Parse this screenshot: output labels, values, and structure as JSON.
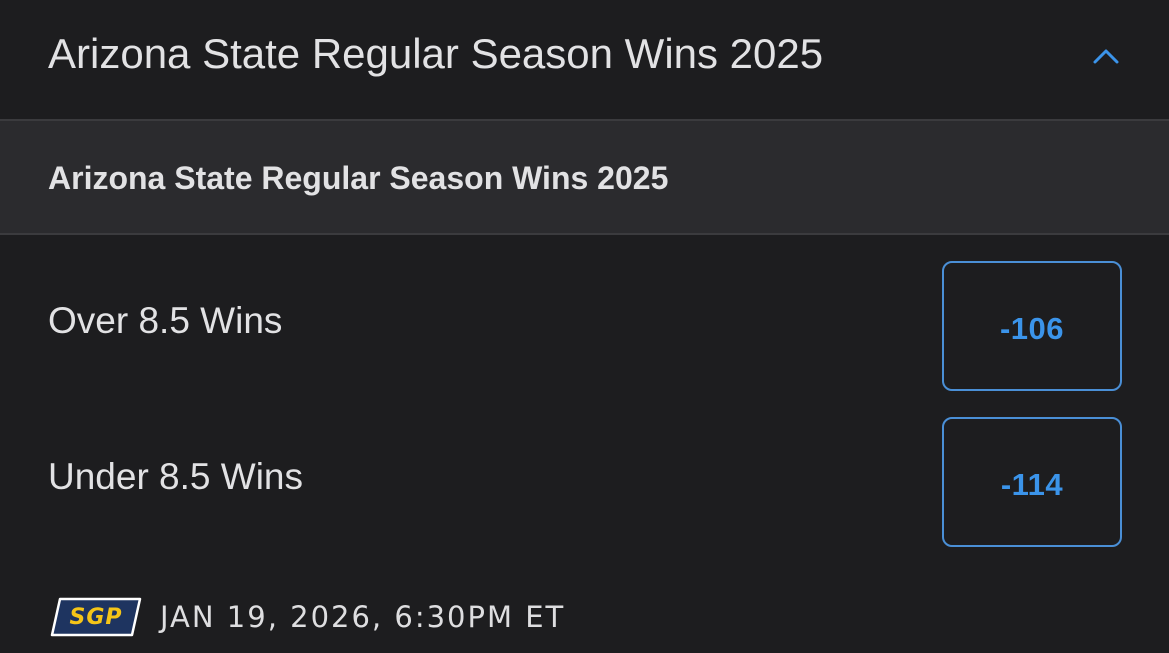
{
  "header": {
    "title": "Arizona State Regular Season Wins 2025",
    "collapse_icon": "chevron-up-icon",
    "accent_color": "#3b94ea"
  },
  "market": {
    "title": "Arizona State Regular Season Wins 2025",
    "outcomes": [
      {
        "label": "Over 8.5 Wins",
        "odds": "-106"
      },
      {
        "label": "Under 8.5 Wins",
        "odds": "-114"
      }
    ]
  },
  "footer": {
    "badge": "SGP",
    "badge_colors": {
      "background": "#1e3460",
      "text": "#f5c518",
      "border": "#ffffff"
    },
    "event_time": "JAN 19, 2026, 6:30PM ET"
  },
  "colors": {
    "background": "#1d1d1f",
    "subheader_background": "#2b2b2e",
    "odds_border": "#4a8fd6",
    "odds_text": "#3b94ea"
  }
}
